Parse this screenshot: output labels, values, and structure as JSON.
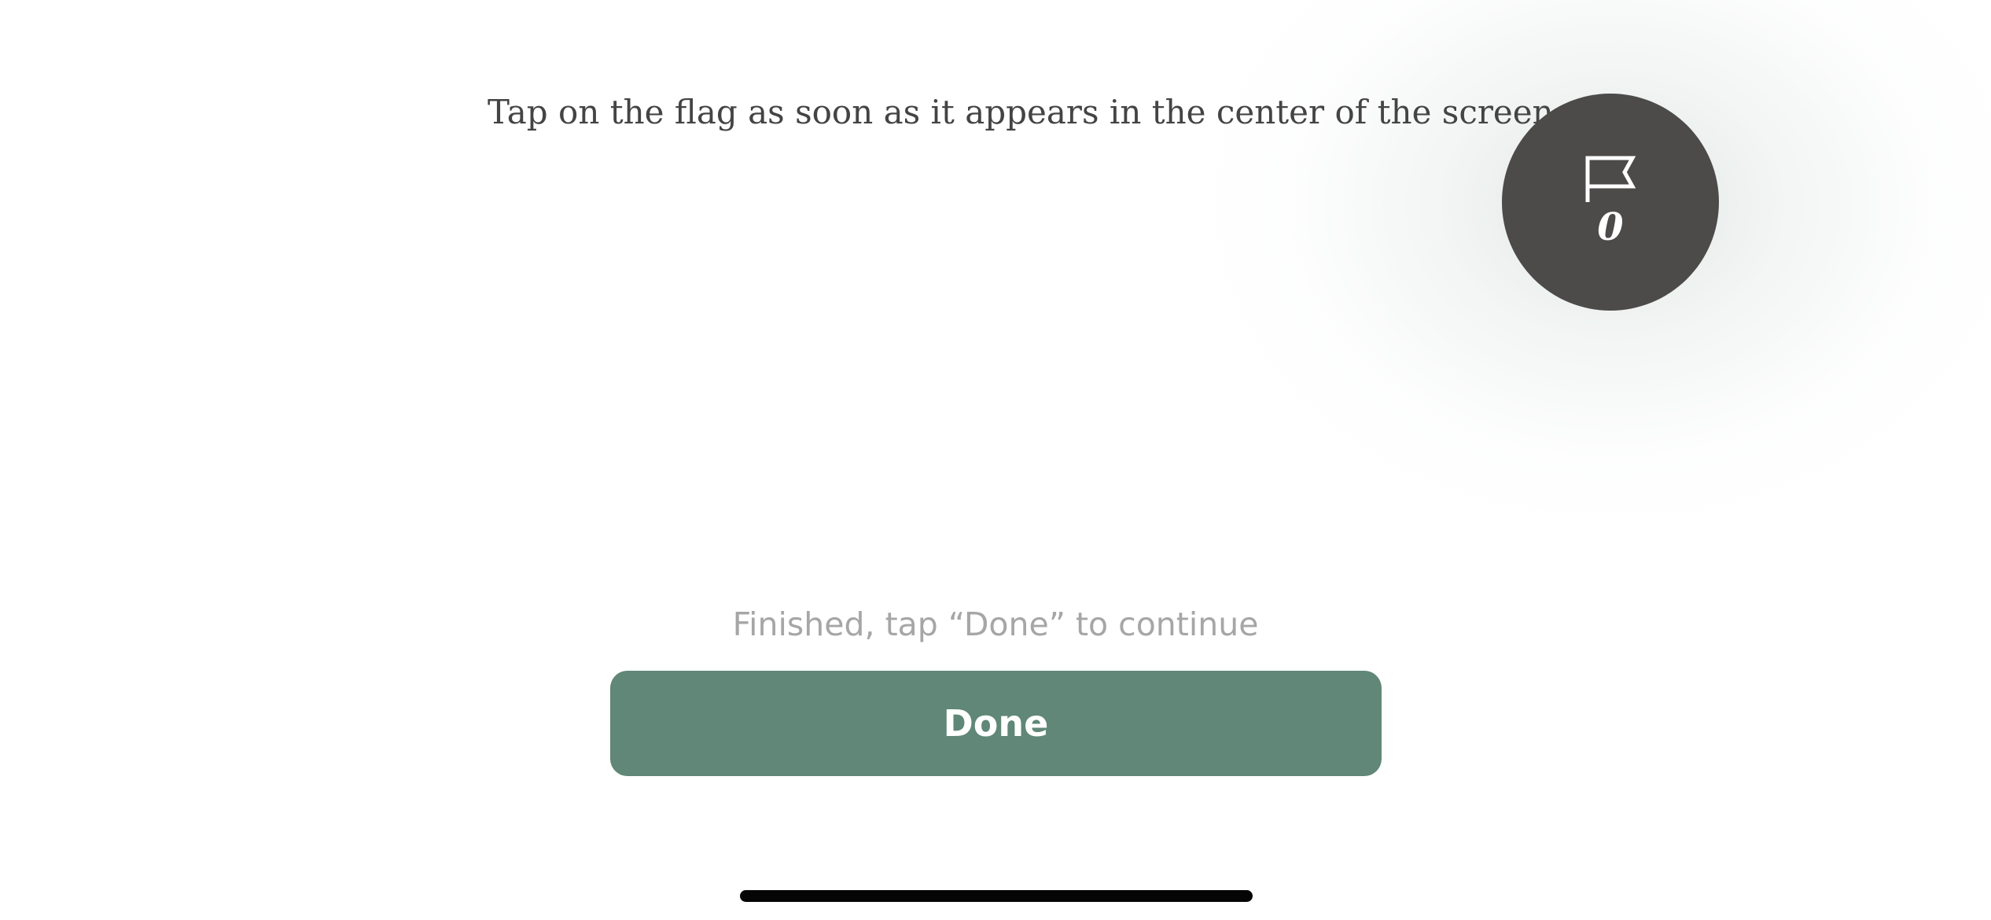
{
  "instruction": {
    "text": "Tap on the flag as soon as it appears in the center of the screen."
  },
  "flag_counter": {
    "icon": "flag-icon",
    "count": "0",
    "background": "#4d4a4a"
  },
  "footer": {
    "status_text": "Finished, tap “Done” to continue",
    "done_label": "Done",
    "done_color": "#608777"
  }
}
